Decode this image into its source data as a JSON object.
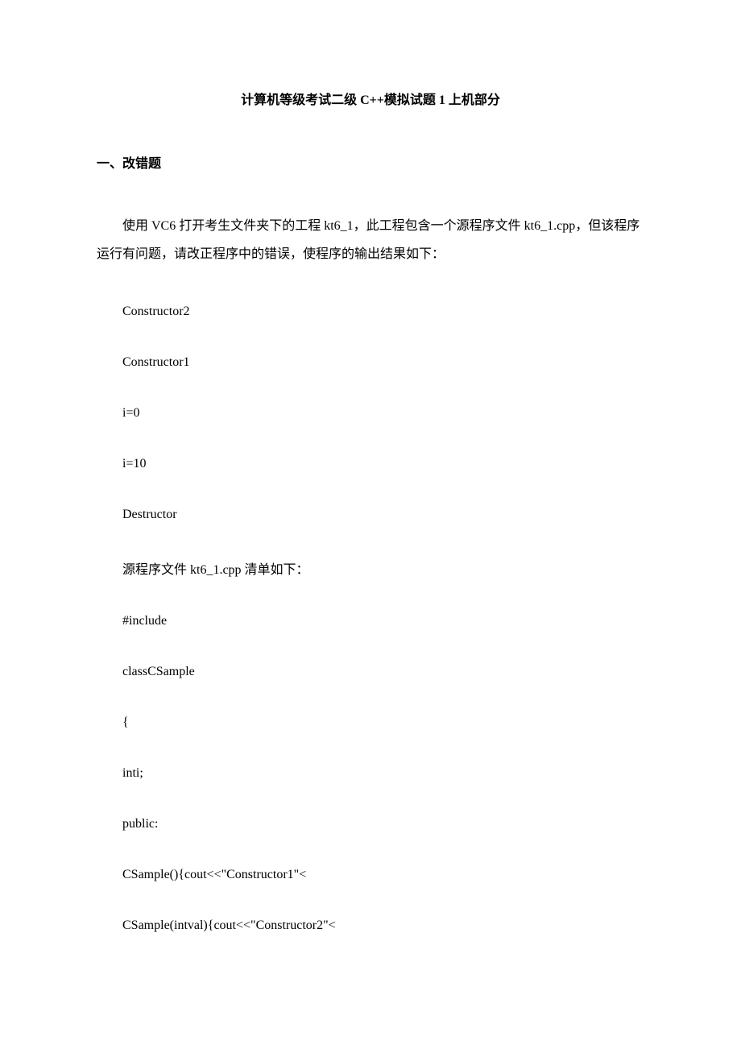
{
  "title": "计算机等级考试二级 C++模拟试题 1 上机部分",
  "section1": {
    "header": "一、改错题",
    "intro": "使用 VC6 打开考生文件夹下的工程 kt6_1，此工程包含一个源程序文件 kt6_1.cpp，但该程序运行有问题，请改正程序中的错误，使程序的输出结果如下：",
    "lines": [
      "Constructor2",
      "Constructor1",
      "i=0",
      "i=10",
      "Destructor",
      "源程序文件 kt6_1.cpp 清单如下：",
      "#include",
      "classCSample",
      "{",
      "inti;",
      "public:",
      "CSample(){cout<<\"Constructor1\"<",
      "CSample(intval){cout<<\"Constructor2\"<"
    ]
  }
}
